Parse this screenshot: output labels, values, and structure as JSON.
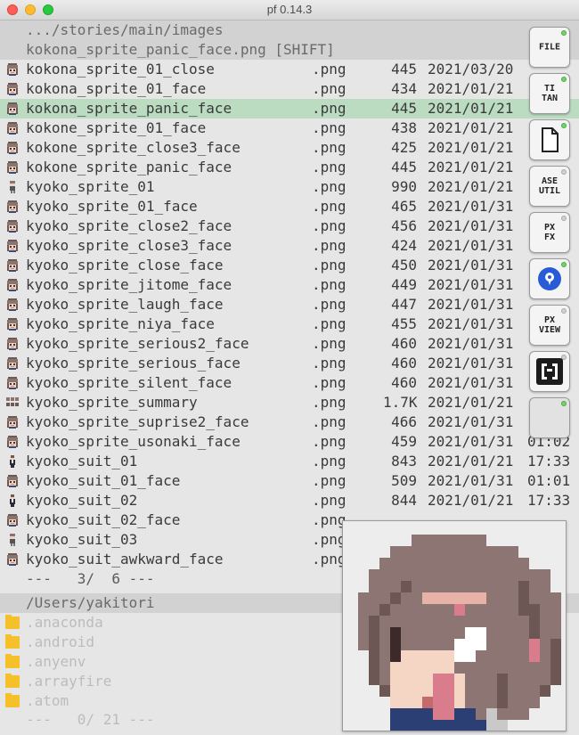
{
  "window": {
    "title": "pf 0.14.3"
  },
  "images_panel": {
    "path": ".../stories/main/images",
    "status": "kokona_sprite_panic_face.png [SHIFT]",
    "files": [
      {
        "name": "kokona_sprite_01_close",
        "ext": ".png",
        "size": "445",
        "date": "2021/03/20",
        "time": "",
        "icon": "face-icon"
      },
      {
        "name": "kokona_sprite_01_face",
        "ext": ".png",
        "size": "434",
        "date": "2021/01/21",
        "time": "",
        "icon": "face-icon"
      },
      {
        "name": "kokona_sprite_panic_face",
        "ext": ".png",
        "size": "445",
        "date": "2021/01/21",
        "time": "",
        "icon": "face-icon",
        "selected": true
      },
      {
        "name": "kokone_sprite_01_face",
        "ext": ".png",
        "size": "438",
        "date": "2021/01/21",
        "time": "",
        "icon": "face-icon"
      },
      {
        "name": "kokone_sprite_close3_face",
        "ext": ".png",
        "size": "425",
        "date": "2021/01/21",
        "time": "",
        "icon": "face-icon"
      },
      {
        "name": "kokone_sprite_panic_face",
        "ext": ".png",
        "size": "445",
        "date": "2021/01/21",
        "time": "",
        "icon": "face-icon"
      },
      {
        "name": "kyoko_sprite_01",
        "ext": ".png",
        "size": "990",
        "date": "2021/01/21",
        "time": "",
        "icon": "sprite-icon"
      },
      {
        "name": "kyoko_sprite_01_face",
        "ext": ".png",
        "size": "465",
        "date": "2021/01/31",
        "time": "",
        "icon": "face-icon"
      },
      {
        "name": "kyoko_sprite_close2_face",
        "ext": ".png",
        "size": "456",
        "date": "2021/01/31",
        "time": "",
        "icon": "face-icon"
      },
      {
        "name": "kyoko_sprite_close3_face",
        "ext": ".png",
        "size": "424",
        "date": "2021/01/31",
        "time": "",
        "icon": "face-icon"
      },
      {
        "name": "kyoko_sprite_close_face",
        "ext": ".png",
        "size": "450",
        "date": "2021/01/31",
        "time": "",
        "icon": "face-icon"
      },
      {
        "name": "kyoko_sprite_jitome_face",
        "ext": ".png",
        "size": "449",
        "date": "2021/01/31",
        "time": "",
        "icon": "face-icon"
      },
      {
        "name": "kyoko_sprite_laugh_face",
        "ext": ".png",
        "size": "447",
        "date": "2021/01/31",
        "time": "",
        "icon": "face-icon"
      },
      {
        "name": "kyoko_sprite_niya_face",
        "ext": ".png",
        "size": "455",
        "date": "2021/01/31",
        "time": "",
        "icon": "face-icon"
      },
      {
        "name": "kyoko_sprite_serious2_face",
        "ext": ".png",
        "size": "460",
        "date": "2021/01/31",
        "time": "",
        "icon": "face-icon"
      },
      {
        "name": "kyoko_sprite_serious_face",
        "ext": ".png",
        "size": "460",
        "date": "2021/01/31",
        "time": "",
        "icon": "face-icon"
      },
      {
        "name": "kyoko_sprite_silent_face",
        "ext": ".png",
        "size": "460",
        "date": "2021/01/31",
        "time": "",
        "icon": "face-icon"
      },
      {
        "name": "kyoko_sprite_summary",
        "ext": ".png",
        "size": "1.7K",
        "date": "2021/01/21",
        "time": "",
        "icon": "summary-icon"
      },
      {
        "name": "kyoko_sprite_suprise2_face",
        "ext": ".png",
        "size": "466",
        "date": "2021/01/31",
        "time": "",
        "icon": "face-icon"
      },
      {
        "name": "kyoko_sprite_usonaki_face",
        "ext": ".png",
        "size": "459",
        "date": "2021/01/31",
        "time": "01:02",
        "icon": "face-icon"
      },
      {
        "name": "kyoko_suit_01",
        "ext": ".png",
        "size": "843",
        "date": "2021/01/21",
        "time": "17:33",
        "icon": "suit-icon"
      },
      {
        "name": "kyoko_suit_01_face",
        "ext": ".png",
        "size": "509",
        "date": "2021/01/31",
        "time": "01:01",
        "icon": "face-icon"
      },
      {
        "name": "kyoko_suit_02",
        "ext": ".png",
        "size": "844",
        "date": "2021/01/21",
        "time": "17:33",
        "icon": "suit-icon"
      },
      {
        "name": "kyoko_suit_02_face",
        "ext": ".png",
        "size": "",
        "date": "",
        "time": "",
        "icon": "face-icon"
      },
      {
        "name": "kyoko_suit_03",
        "ext": ".png",
        "size": "",
        "date": "",
        "time": "",
        "icon": "sprite-icon"
      },
      {
        "name": "kyoko_suit_awkward_face",
        "ext": ".png",
        "size": "",
        "date": "",
        "time": "",
        "icon": "face-icon"
      }
    ],
    "footer": "---   3/  6 ---"
  },
  "home_panel": {
    "path": "/Users/yakitori",
    "folders": [
      {
        "name": ".anaconda",
        "icon": "folder-icon"
      },
      {
        "name": ".android",
        "icon": "folder-icon"
      },
      {
        "name": ".anyenv",
        "icon": "folder-icon"
      },
      {
        "name": ".arrayfire",
        "icon": "folder-icon"
      },
      {
        "name": ".atom",
        "icon": "folder-icon"
      }
    ],
    "footer": "---   0/ 21 ---"
  },
  "tools": [
    {
      "label": "FILE",
      "status": "on"
    },
    {
      "label": "TI\nTAN",
      "status": "on"
    },
    {
      "label": "",
      "icon": "document-icon",
      "status": "on"
    },
    {
      "label": "ASE\nUTIL",
      "status": "off"
    },
    {
      "label": "PX\nFX",
      "status": "off"
    },
    {
      "label": "",
      "icon": "location-pin-icon",
      "status": "on"
    },
    {
      "label": "PX\nVIEW",
      "status": "off"
    },
    {
      "label": "",
      "icon": "brackets-logo-icon",
      "status": "off"
    },
    {
      "label": "",
      "icon": "blank-icon",
      "status": "on"
    }
  ],
  "colors": {
    "selection": "#bcdcc2",
    "header_bg": "#d2d2d2",
    "folder": "#f6c02b",
    "status_on": "#6fd66a",
    "pin_blue": "#2a5bd7"
  },
  "preview": {
    "icon": "pixel-art-face-preview"
  }
}
